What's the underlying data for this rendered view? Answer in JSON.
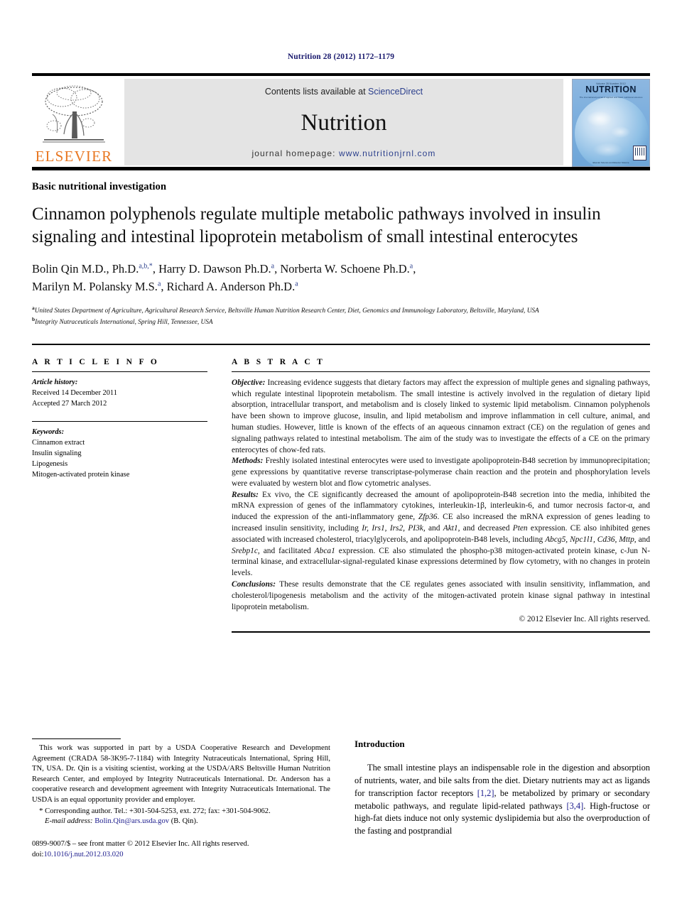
{
  "running_head": "Nutrition 28 (2012) 1172–1179",
  "masthead": {
    "publisher_name": "ELSEVIER",
    "contents_prefix": "Contents lists available at ",
    "contents_link": "ScienceDirect",
    "journal_title": "Nutrition",
    "homepage_prefix": "journal homepage: ",
    "homepage_url": "www.nutritionjrnl.com",
    "cover": {
      "kicker": "Volume 28 Number 2012",
      "name": "NUTRITION",
      "subtitle": "The international journal of applied and basic nutritional sciences",
      "footer": "Elsevier Science and Elsevier Science"
    }
  },
  "article": {
    "kicker": "Basic nutritional investigation",
    "title": "Cinnamon polyphenols regulate multiple metabolic pathways involved in insulin signaling and intestinal lipoprotein metabolism of small intestinal enterocytes",
    "authors_line_1": "Bolin Qin M.D., Ph.D.",
    "authors_marks_1": "a,b,*",
    "authors_2": ", Harry D. Dawson Ph.D.",
    "authors_marks_2": "a",
    "authors_3": ", Norberta W. Schoene Ph.D.",
    "authors_marks_3": "a",
    "authors_4": ",",
    "authors_line_2a": "Marilyn M. Polansky M.S.",
    "authors_marks_4": "a",
    "authors_5": ", Richard A. Anderson Ph.D.",
    "authors_marks_5": "a",
    "affiliation_a_mark": "a",
    "affiliation_a": "United States Department of Agriculture, Agricultural Research Service, Beltsville Human Nutrition Research Center, Diet, Genomics and Immunology Laboratory, Beltsville, Maryland, USA",
    "affiliation_b_mark": "b",
    "affiliation_b": "Integrity Nutraceuticals International, Spring Hill, Tennessee, USA"
  },
  "article_info": {
    "heading": "A R T I C L E   I N F O",
    "history_label": "Article history:",
    "received": "Received 14 December 2011",
    "accepted": "Accepted 27 March 2012",
    "keywords_label": "Keywords:",
    "keywords": [
      "Cinnamon extract",
      "Insulin signaling",
      "Lipogenesis",
      "Mitogen-activated protein kinase"
    ]
  },
  "abstract": {
    "heading": "A B S T R A C T",
    "objective_label": "Objective:",
    "objective_text": " Increasing evidence suggests that dietary factors may affect the expression of multiple genes and signaling pathways, which regulate intestinal lipoprotein metabolism. The small intestine is actively involved in the regulation of dietary lipid absorption, intracellular transport, and metabolism and is closely linked to systemic lipid metabolism. Cinnamon polyphenols have been shown to improve glucose, insulin, and lipid metabolism and improve inflammation in cell culture, animal, and human studies. However, little is known of the effects of an aqueous cinnamon extract (CE) on the regulation of genes and signaling pathways related to intestinal metabolism. The aim of the study was to investigate the effects of a CE on the primary enterocytes of chow-fed rats.",
    "methods_label": "Methods:",
    "methods_text": " Freshly isolated intestinal enterocytes were used to investigate apolipoprotein-B48 secretion by immunoprecipitation; gene expressions by quantitative reverse transcriptase-polymerase chain reaction and the protein and phosphorylation levels were evaluated by western blot and flow cytometric analyses.",
    "results_label": "Results:",
    "results_part1": " Ex vivo, the CE significantly decreased the amount of apolipoprotein-B48 secretion into the media, inhibited the mRNA expression of genes of the inflammatory cytokines, interleukin-1β, interleukin-6, and tumor necrosis factor-α, and induced the expression of the anti-inflammatory gene, ",
    "results_gene1": "Zfp36",
    "results_part2": ". CE also increased the mRNA expression of genes leading to increased insulin sensitivity, including ",
    "results_gene2": "Ir, Irs1, Irs2, PI3k,",
    "results_part3": " and ",
    "results_gene3": "Akt1",
    "results_part4": ", and decreased ",
    "results_gene4": "Pten",
    "results_part5": " expression. CE also inhibited genes associated with increased cholesterol, triacylglycerols, and apolipoprotein-B48 levels, including ",
    "results_gene5": "Abcg5, Npc1l1, Cd36, Mttp,",
    "results_part6": " and ",
    "results_gene6": "Srebp1c",
    "results_part7": ", and facilitated ",
    "results_gene7": "Abca1",
    "results_part8": " expression. CE also stimulated the phospho-p38 mitogen-activated protein kinase, c-Jun N-terminal kinase, and extracellular-signal-regulated kinase expressions determined by flow cytometry, with no changes in protein levels.",
    "conclusions_label": "Conclusions:",
    "conclusions_text": " These results demonstrate that the CE regulates genes associated with insulin sensitivity, inflammation, and cholesterol/lipogenesis metabolism and the activity of the mitogen-activated protein kinase signal pathway in intestinal lipoprotein metabolism.",
    "copyright": "© 2012 Elsevier Inc. All rights reserved."
  },
  "footnotes": {
    "funding": "This work was supported in part by a USDA Cooperative Research and Development Agreement (CRADA 58-3K95-7-1184) with Integrity Nutraceuticals International, Spring Hill, TN, USA. Dr. Qin is a visiting scientist, working at the USDA/ARS Beltsville Human Nutrition Research Center, and employed by Integrity Nutraceuticals International. Dr. Anderson has a cooperative research and development agreement with Integrity Nutraceuticals International. The USDA is an equal opportunity provider and employer.",
    "corresponding_star": "*",
    "corresponding": " Corresponding author. Tel.: +301-504-5253, ext. 272; fax: +301-504-9062.",
    "email_label": "E-mail address:",
    "email": "Bolin.Qin@ars.usda.gov",
    "email_suffix": " (B. Qin).",
    "issn_line": "0899-9007/$ – see front matter © 2012 Elsevier Inc. All rights reserved.",
    "doi_label": "doi:",
    "doi": "10.1016/j.nut.2012.03.020"
  },
  "introduction": {
    "heading": "Introduction",
    "para_part1": "The small intestine plays an indispensable role in the digestion and absorption of nutrients, water, and bile salts from the diet. Dietary nutrients may act as ligands for transcription factor receptors ",
    "ref1": "[1,2]",
    "para_part2": ", be metabolized by primary or secondary metabolic pathways, and regulate lipid-related pathways ",
    "ref2": "[3,4]",
    "para_part3": ". High-fructose or high-fat diets induce not only systemic dyslipidemia but also the overproduction of the fasting and postprandial"
  },
  "colors": {
    "link": "#1a1a8c",
    "elsevier_orange": "#E87722",
    "sciencedirect_blue": "#2b3f8c",
    "band_gray": "#e4e4e4"
  }
}
